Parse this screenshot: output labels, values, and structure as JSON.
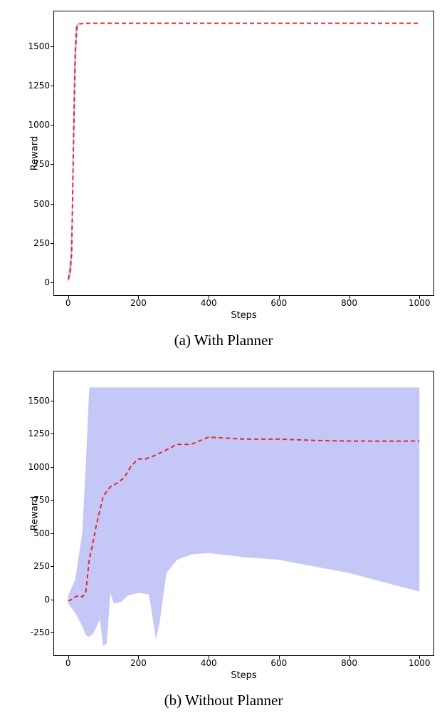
{
  "chart_data": [
    {
      "id": "a",
      "type": "line",
      "title": "",
      "caption": "(a) With Planner",
      "xlabel": "Steps",
      "ylabel": "Reward",
      "xlim": [
        -40,
        1040
      ],
      "ylim": [
        -80,
        1720
      ],
      "xticks": [
        0,
        200,
        400,
        600,
        800,
        1000
      ],
      "yticks": [
        0,
        250,
        500,
        750,
        1000,
        1250,
        1500
      ],
      "series": [
        {
          "name": "mean",
          "style": "dashed-red",
          "x": [
            0,
            5,
            10,
            15,
            20,
            25,
            30,
            50,
            100,
            200,
            400,
            600,
            800,
            1000
          ],
          "y": [
            20,
            60,
            180,
            850,
            1450,
            1620,
            1640,
            1645,
            1645,
            1645,
            1645,
            1645,
            1645,
            1645
          ]
        }
      ],
      "band": {
        "x": [
          0,
          5,
          10,
          15,
          20,
          25,
          30,
          50,
          100,
          200,
          400,
          600,
          800,
          1000
        ],
        "lower": [
          0,
          20,
          80,
          700,
          1150,
          1570,
          1640,
          1645,
          1645,
          1645,
          1645,
          1645,
          1645,
          1645
        ],
        "upper": [
          50,
          150,
          400,
          1200,
          1620,
          1645,
          1645,
          1645,
          1645,
          1645,
          1645,
          1645,
          1645,
          1645
        ]
      }
    },
    {
      "id": "b",
      "type": "line",
      "title": "",
      "caption": "(b) Without Planner",
      "xlabel": "Steps",
      "ylabel": "Reward",
      "xlim": [
        -40,
        1040
      ],
      "ylim": [
        -420,
        1720
      ],
      "xticks": [
        0,
        200,
        400,
        600,
        800,
        1000
      ],
      "yticks": [
        -250,
        0,
        250,
        500,
        750,
        1000,
        1250,
        1500
      ],
      "series": [
        {
          "name": "mean",
          "style": "dashed-red",
          "x": [
            0,
            10,
            20,
            30,
            40,
            50,
            60,
            70,
            80,
            100,
            120,
            140,
            160,
            180,
            200,
            220,
            250,
            280,
            310,
            350,
            400,
            500,
            600,
            700,
            800,
            900,
            1000
          ],
          "y": [
            -10,
            0,
            20,
            30,
            20,
            50,
            300,
            420,
            560,
            780,
            850,
            880,
            920,
            1010,
            1060,
            1060,
            1090,
            1130,
            1170,
            1170,
            1225,
            1210,
            1210,
            1200,
            1195,
            1195,
            1195
          ]
        }
      ],
      "band": {
        "x": [
          0,
          20,
          40,
          50,
          60,
          70,
          80,
          90,
          100,
          110,
          120,
          130,
          150,
          170,
          200,
          230,
          250,
          260,
          280,
          310,
          350,
          400,
          500,
          600,
          700,
          800,
          900,
          1000
        ],
        "lower": [
          -30,
          -100,
          -200,
          -270,
          -280,
          -260,
          -210,
          -150,
          -350,
          -330,
          50,
          -30,
          -20,
          30,
          50,
          40,
          -300,
          -180,
          200,
          300,
          340,
          350,
          320,
          300,
          250,
          200,
          130,
          60
        ],
        "upper": [
          30,
          150,
          500,
          1000,
          1600,
          1600,
          1600,
          1600,
          1600,
          1600,
          1600,
          1600,
          1600,
          1600,
          1600,
          1600,
          1600,
          1600,
          1600,
          1600,
          1600,
          1600,
          1600,
          1600,
          1600,
          1600,
          1600,
          1600
        ]
      }
    }
  ],
  "colors": {
    "band": "#9ea1f0",
    "line": "#e8252b"
  }
}
